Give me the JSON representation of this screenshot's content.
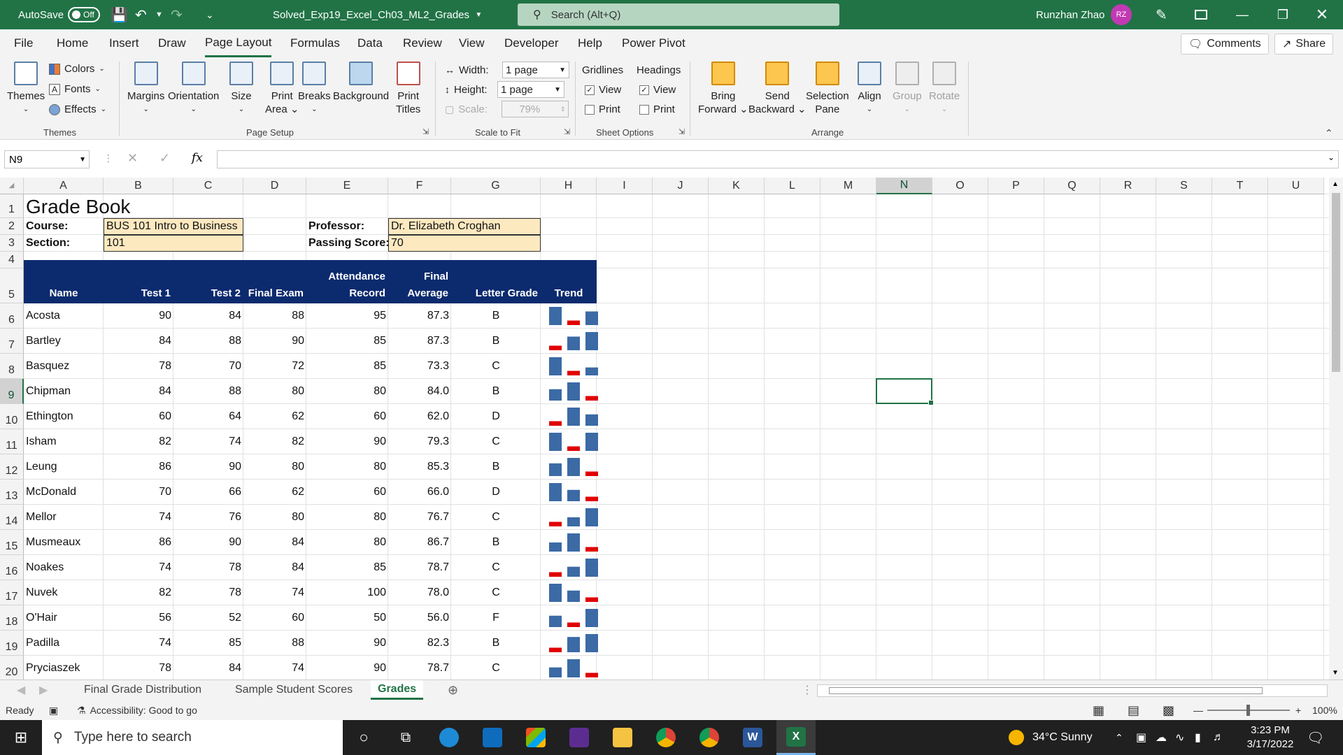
{
  "titlebar": {
    "autosave_label": "AutoSave",
    "autosave_state": "Off",
    "filename": "Solved_Exp19_Excel_Ch03_ML2_Grades",
    "search_placeholder": "Search (Alt+Q)",
    "user_name": "Runzhan Zhao",
    "user_initials": "RZ"
  },
  "menu": {
    "tabs": [
      "File",
      "Home",
      "Insert",
      "Draw",
      "Page Layout",
      "Formulas",
      "Data",
      "Review",
      "View",
      "Developer",
      "Help",
      "Power Pivot"
    ],
    "active_tab": "Page Layout",
    "comments_label": "Comments",
    "share_label": "Share"
  },
  "ribbon": {
    "themes": {
      "themes": "Themes",
      "colors": "Colors",
      "fonts": "Fonts",
      "effects": "Effects",
      "group": "Themes"
    },
    "page_setup": {
      "margins": "Margins",
      "orientation": "Orientation",
      "size": "Size",
      "print_area_1": "Print",
      "print_area_2": "Area",
      "breaks": "Breaks",
      "background": "Background",
      "print_titles_1": "Print",
      "print_titles_2": "Titles",
      "group": "Page Setup"
    },
    "scale": {
      "width_label": "Width:",
      "width_value": "1 page",
      "height_label": "Height:",
      "height_value": "1 page",
      "scale_label": "Scale:",
      "scale_value": "79%",
      "group": "Scale to Fit"
    },
    "sheet_options": {
      "gridlines": "Gridlines",
      "headings": "Headings",
      "view": "View",
      "print": "Print",
      "group": "Sheet Options",
      "gridlines_view": true,
      "gridlines_print": false,
      "headings_view": true,
      "headings_print": false
    },
    "arrange": {
      "bring_1": "Bring",
      "bring_2": "Forward",
      "send_1": "Send",
      "send_2": "Backward",
      "selection_1": "Selection",
      "selection_2": "Pane",
      "align": "Align",
      "group_btn": "Group",
      "rotate": "Rotate",
      "group": "Arrange"
    }
  },
  "formula_bar": {
    "name_box": "N9",
    "fx": "fx",
    "content": ""
  },
  "columns": [
    "A",
    "B",
    "C",
    "D",
    "E",
    "F",
    "G",
    "H",
    "I",
    "J",
    "K",
    "L",
    "M",
    "N",
    "O",
    "P",
    "Q",
    "R",
    "S",
    "T",
    "U"
  ],
  "selected_column": "N",
  "selected_row": 9,
  "rows": [
    1,
    2,
    3,
    4,
    5,
    6,
    7,
    8,
    9,
    10,
    11,
    12,
    13,
    14,
    15,
    16,
    17,
    18,
    19,
    20
  ],
  "sheet": {
    "title": "Grade Book",
    "course_label": "Course:",
    "course_value": "BUS 101 Intro to Business",
    "section_label": "Section:",
    "section_value": "101",
    "professor_label": "Professor:",
    "professor_value": "Dr. Elizabeth Croghan",
    "passing_label": "Passing Score:",
    "passing_value": "70",
    "headers": {
      "name": "Name",
      "test1": "Test 1",
      "test2": "Test 2",
      "final_exam": "Final Exam",
      "attendance_1": "Attendance",
      "attendance_2": "Record",
      "final_avg_1": "Final",
      "final_avg_2": "Average",
      "letter": "Letter Grade",
      "trend": "Trend"
    },
    "students": [
      {
        "name": "Acosta",
        "t1": "90",
        "t2": "84",
        "fe": "88",
        "att": "95",
        "avg": "87.3",
        "grade": "B"
      },
      {
        "name": "Bartley",
        "t1": "84",
        "t2": "88",
        "fe": "90",
        "att": "85",
        "avg": "87.3",
        "grade": "B"
      },
      {
        "name": "Basquez",
        "t1": "78",
        "t2": "70",
        "fe": "72",
        "att": "85",
        "avg": "73.3",
        "grade": "C"
      },
      {
        "name": "Chipman",
        "t1": "84",
        "t2": "88",
        "fe": "80",
        "att": "80",
        "avg": "84.0",
        "grade": "B"
      },
      {
        "name": "Ethington",
        "t1": "60",
        "t2": "64",
        "fe": "62",
        "att": "60",
        "avg": "62.0",
        "grade": "D"
      },
      {
        "name": "Isham",
        "t1": "82",
        "t2": "74",
        "fe": "82",
        "att": "90",
        "avg": "79.3",
        "grade": "C"
      },
      {
        "name": "Leung",
        "t1": "86",
        "t2": "90",
        "fe": "80",
        "att": "80",
        "avg": "85.3",
        "grade": "B"
      },
      {
        "name": "McDonald",
        "t1": "70",
        "t2": "66",
        "fe": "62",
        "att": "60",
        "avg": "66.0",
        "grade": "D"
      },
      {
        "name": "Mellor",
        "t1": "74",
        "t2": "76",
        "fe": "80",
        "att": "80",
        "avg": "76.7",
        "grade": "C"
      },
      {
        "name": "Musmeaux",
        "t1": "86",
        "t2": "90",
        "fe": "84",
        "att": "80",
        "avg": "86.7",
        "grade": "B"
      },
      {
        "name": "Noakes",
        "t1": "74",
        "t2": "78",
        "fe": "84",
        "att": "85",
        "avg": "78.7",
        "grade": "C"
      },
      {
        "name": "Nuvek",
        "t1": "82",
        "t2": "78",
        "fe": "74",
        "att": "100",
        "avg": "78.0",
        "grade": "C"
      },
      {
        "name": "O'Hair",
        "t1": "56",
        "t2": "52",
        "fe": "60",
        "att": "50",
        "avg": "56.0",
        "grade": "F"
      },
      {
        "name": "Padilla",
        "t1": "74",
        "t2": "85",
        "fe": "88",
        "att": "90",
        "avg": "82.3",
        "grade": "B"
      },
      {
        "name": "Pryciaszek",
        "t1": "78",
        "t2": "84",
        "fe": "74",
        "att": "90",
        "avg": "78.7",
        "grade": "C"
      }
    ]
  },
  "sheet_tabs": [
    "Final Grade Distribution",
    "Sample Student Scores",
    "Grades"
  ],
  "active_sheet": "Grades",
  "status": {
    "ready": "Ready",
    "accessibility": "Accessibility: Good to go",
    "zoom": "100%"
  },
  "taskbar": {
    "search_placeholder": "Type here to search",
    "weather": "34°C  Sunny",
    "time": "3:23 PM",
    "date": "3/17/2022"
  },
  "colors": {
    "excel_green": "#217346",
    "header_navy": "#0c2a6e",
    "spark_blue": "#3b6aa5",
    "spark_red": "#e00000",
    "input_fill": "#fde9c0"
  }
}
